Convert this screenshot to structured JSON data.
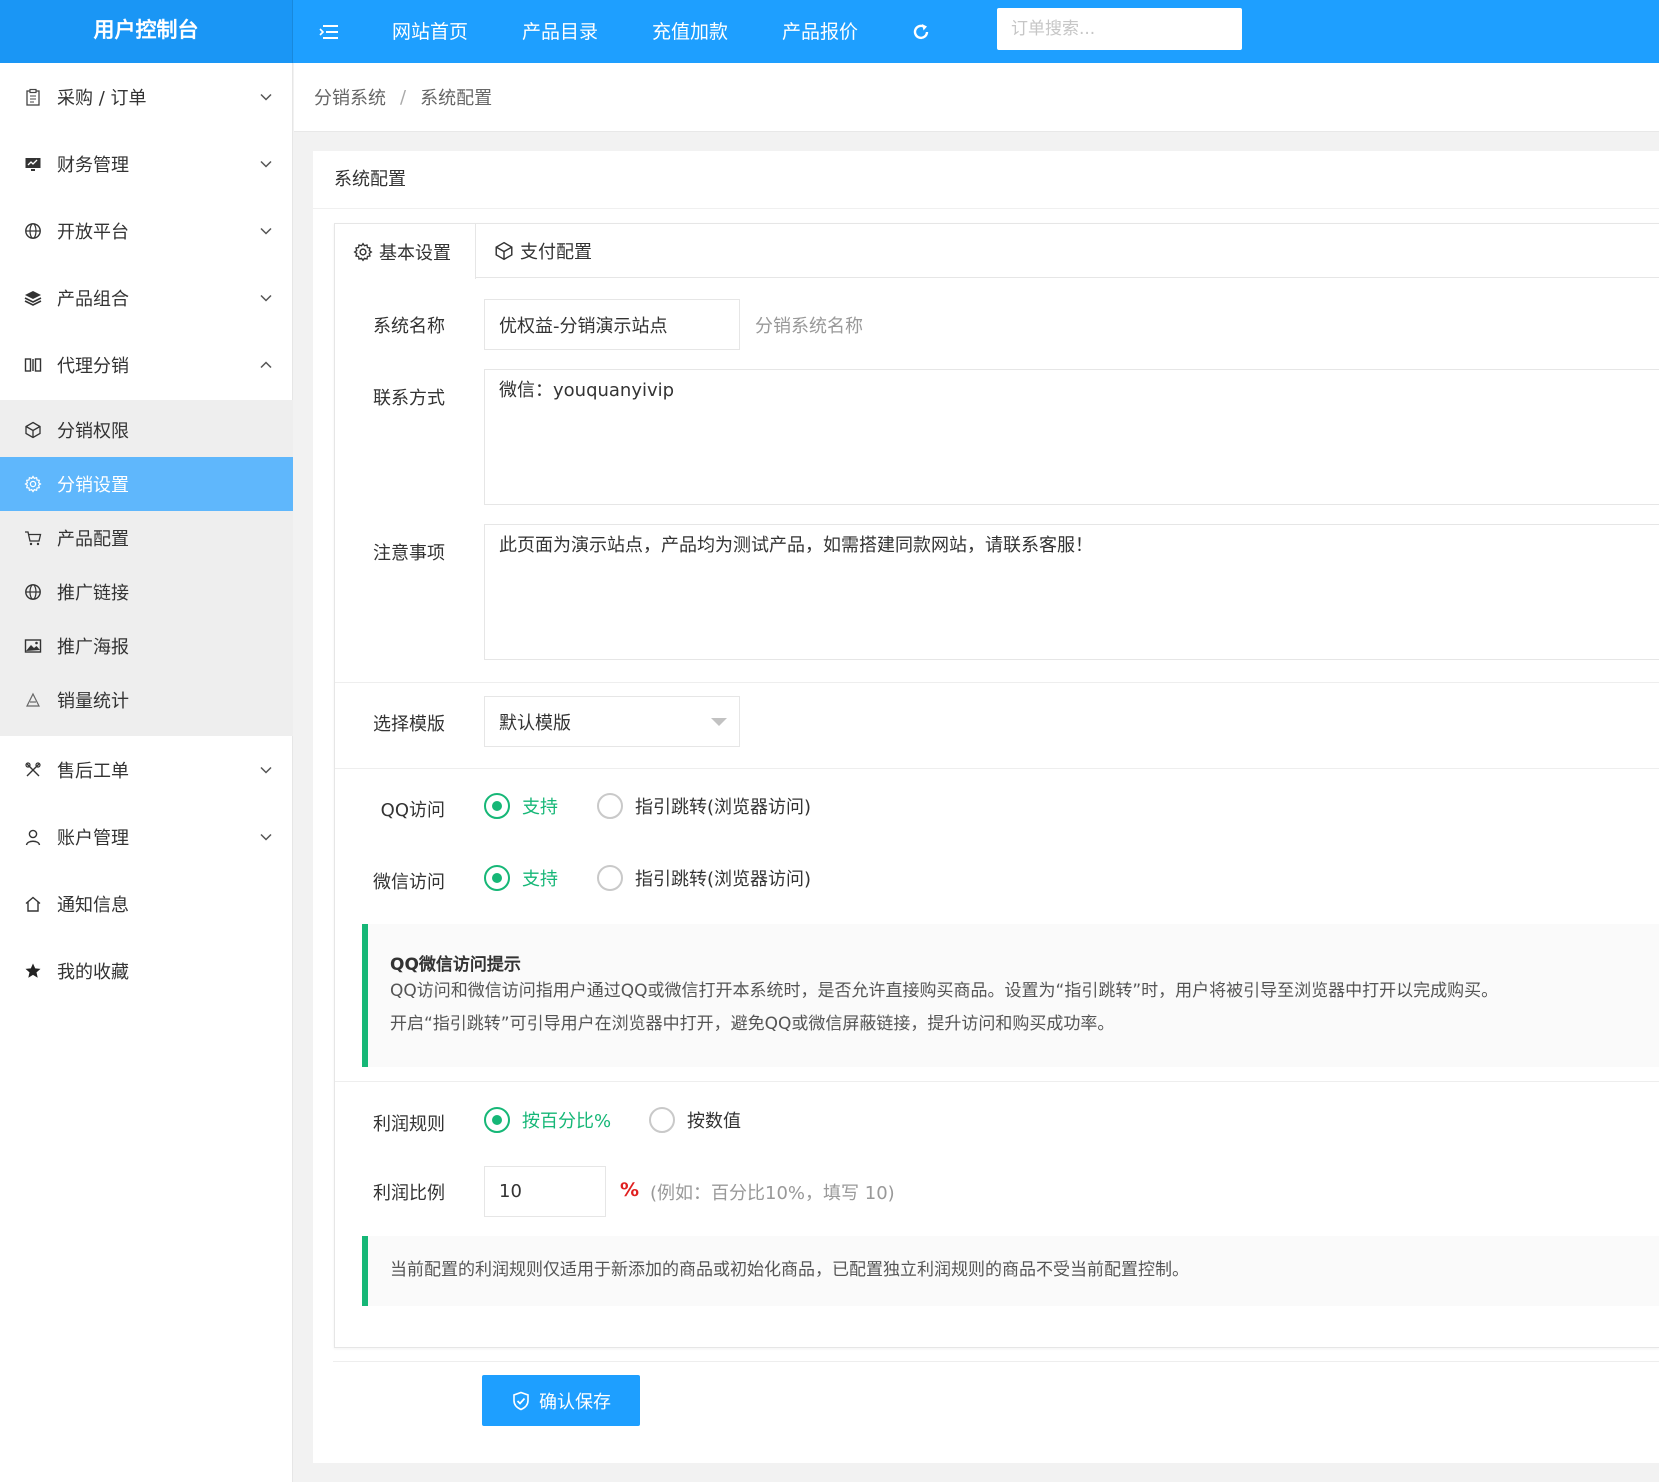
{
  "header": {
    "brand": "用户控制台",
    "nav": [
      "网站首页",
      "产品目录",
      "充值加款",
      "产品报价"
    ],
    "search_placeholder": "订单搜索..."
  },
  "sidebar": {
    "items": [
      {
        "label": "采购 / 订单",
        "icon": "clipboard-icon"
      },
      {
        "label": "财务管理",
        "icon": "monitor-chart-icon"
      },
      {
        "label": "开放平台",
        "icon": "globe-icon"
      },
      {
        "label": "产品组合",
        "icon": "layers-icon"
      },
      {
        "label": "代理分销",
        "icon": "columns-icon"
      }
    ],
    "sub_items": [
      {
        "label": "分销权限",
        "icon": "cube-icon"
      },
      {
        "label": "分销设置",
        "icon": "gear-icon"
      },
      {
        "label": "产品配置",
        "icon": "cart-icon"
      },
      {
        "label": "推广链接",
        "icon": "globe-icon"
      },
      {
        "label": "推广海报",
        "icon": "image-icon"
      },
      {
        "label": "销量统计",
        "icon": "triangle-icon"
      }
    ],
    "bottom_items": [
      {
        "label": "售后工单",
        "icon": "tools-icon"
      },
      {
        "label": "账户管理",
        "icon": "user-icon"
      },
      {
        "label": "通知信息",
        "icon": "home-icon"
      },
      {
        "label": "我的收藏",
        "icon": "star-icon"
      }
    ]
  },
  "breadcrumb": [
    "分销系统",
    "系统配置"
  ],
  "card": {
    "title": "系统配置",
    "tabs": [
      "基本设置",
      "支付配置"
    ]
  },
  "form": {
    "system_name_label": "系统名称",
    "system_name_value": "优权益-分销演示站点",
    "system_name_hint": "分销系统名称",
    "contact_label": "联系方式",
    "contact_value": "微信：youquanyivip",
    "notice_label": "注意事项",
    "notice_value": "此页面为演示站点，产品均为测试产品，如需搭建同款网站，请联系客服！",
    "template_label": "选择模版",
    "template_value": "默认模版",
    "qq_label": "QQ访问",
    "wechat_label": "微信访问",
    "access_options": [
      "支持",
      "指引跳转(浏览器访问)"
    ],
    "access_tip_title": "QQ微信访问提示",
    "access_tip_lines": [
      "QQ访问和微信访问指用户通过QQ或微信打开本系统时，是否允许直接购买商品。设置为“指引跳转”时，用户将被引导至浏览器中打开以完成购买。",
      "开启“指引跳转”可引导用户在浏览器中打开，避免QQ或微信屏蔽链接，提升访问和购买成功率。"
    ],
    "profit_rule_label": "利润规则",
    "profit_rule_options": [
      "按百分比%",
      "按数值"
    ],
    "profit_ratio_label": "利润比例",
    "profit_ratio_value": "10",
    "profit_ratio_unit": "%",
    "profit_ratio_hint": "(例如：百分比10%，填写 10)",
    "profit_note": "当前配置的利润规则仅适用于新添加的商品或初始化商品，已配置独立利润规则的商品不受当前配置控制。",
    "save_label": "确认保存"
  },
  "colors": {
    "primary": "#1e9fff",
    "success": "#16b777",
    "active_menu": "#5fb7fc"
  }
}
